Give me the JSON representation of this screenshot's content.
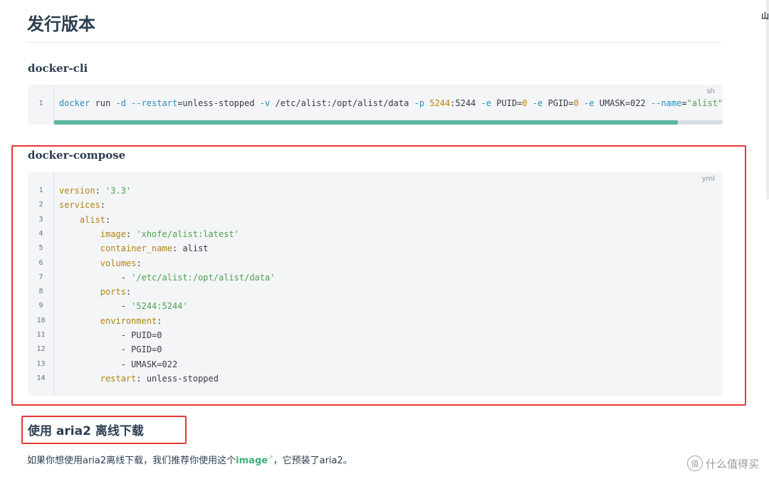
{
  "page": {
    "title": "发行版本",
    "corner_glyph": "山"
  },
  "docker_cli": {
    "heading": "docker-cli",
    "lang": "sh",
    "line_number": "1"
  },
  "docker_compose": {
    "heading": "docker-compose",
    "lang": "yml",
    "lines": [
      {
        "n": "1",
        "segs": [
          {
            "c": "key",
            "t": "version"
          },
          {
            "c": "",
            "t": ": "
          },
          {
            "c": "str",
            "t": "'3.3'"
          }
        ]
      },
      {
        "n": "2",
        "segs": [
          {
            "c": "key",
            "t": "services"
          },
          {
            "c": "",
            "t": ":"
          }
        ]
      },
      {
        "n": "3",
        "segs": [
          {
            "c": "",
            "t": "    "
          },
          {
            "c": "key",
            "t": "alist"
          },
          {
            "c": "",
            "t": ":"
          }
        ]
      },
      {
        "n": "4",
        "segs": [
          {
            "c": "",
            "t": "        "
          },
          {
            "c": "key",
            "t": "image"
          },
          {
            "c": "",
            "t": ": "
          },
          {
            "c": "str",
            "t": "'xhofe/alist:latest'"
          }
        ]
      },
      {
        "n": "5",
        "segs": [
          {
            "c": "",
            "t": "        "
          },
          {
            "c": "key",
            "t": "container_name"
          },
          {
            "c": "",
            "t": ": alist"
          }
        ]
      },
      {
        "n": "6",
        "segs": [
          {
            "c": "",
            "t": "        "
          },
          {
            "c": "key",
            "t": "volumes"
          },
          {
            "c": "",
            "t": ":"
          }
        ]
      },
      {
        "n": "7",
        "segs": [
          {
            "c": "",
            "t": "            - "
          },
          {
            "c": "str",
            "t": "'/etc/alist:/opt/alist/data'"
          }
        ]
      },
      {
        "n": "8",
        "segs": [
          {
            "c": "",
            "t": "        "
          },
          {
            "c": "key",
            "t": "ports"
          },
          {
            "c": "",
            "t": ":"
          }
        ]
      },
      {
        "n": "9",
        "segs": [
          {
            "c": "",
            "t": "            - "
          },
          {
            "c": "str",
            "t": "'5244:5244'"
          }
        ]
      },
      {
        "n": "10",
        "segs": [
          {
            "c": "",
            "t": "        "
          },
          {
            "c": "key",
            "t": "environment"
          },
          {
            "c": "",
            "t": ":"
          }
        ]
      },
      {
        "n": "11",
        "segs": [
          {
            "c": "",
            "t": "            - PUID=0"
          }
        ]
      },
      {
        "n": "12",
        "segs": [
          {
            "c": "",
            "t": "            - PGID=0"
          }
        ]
      },
      {
        "n": "13",
        "segs": [
          {
            "c": "",
            "t": "            - UMASK=022"
          }
        ]
      },
      {
        "n": "14",
        "segs": [
          {
            "c": "",
            "t": "        "
          },
          {
            "c": "key",
            "t": "restart"
          },
          {
            "c": "",
            "t": ": unless-stopped"
          }
        ]
      }
    ]
  },
  "aria2": {
    "heading": "使用 aria2 离线下载",
    "para_before": "如果你想使用aria2离线下载，我们推荐你使用这个",
    "link_text": "image",
    "para_after": "，它预装了aria2。"
  },
  "watermark": {
    "icon_text": "值",
    "text": "什么值得买"
  },
  "colors": {
    "accent": "#3eaf7c",
    "highlight_border": "#e53935",
    "code_bg": "#f3f5f7"
  }
}
